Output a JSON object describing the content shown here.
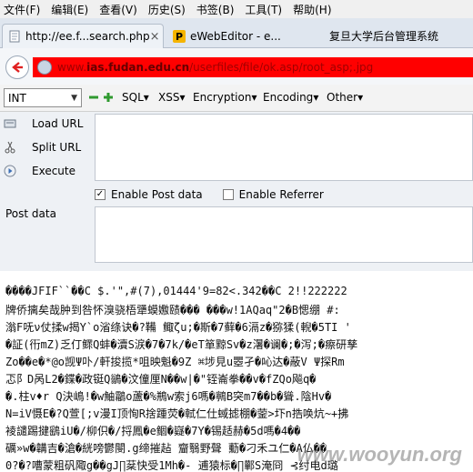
{
  "menu": [
    "文件(F)",
    "编辑(E)",
    "查看(V)",
    "历史(S)",
    "书签(B)",
    "工具(T)",
    "帮助(H)"
  ],
  "tabs": [
    {
      "label": "http://ee.f...search.php",
      "favicon": "page-icon"
    },
    {
      "label": "eWebEditor - e...",
      "favicon": "ewebeditor-icon"
    },
    {
      "label": "复旦大学后台管理系统",
      "favicon": "none"
    }
  ],
  "nav": {
    "url_prefix": "www.",
    "url_domain": "ias.fudan.edu.cn",
    "url_path": "/userfiles/file/ok.asp/root_asp;.jpg"
  },
  "hackbar": {
    "select_value": "INT",
    "menus": [
      "SQL",
      "XSS",
      "Encryption",
      "Encoding",
      "Other"
    ],
    "actions": [
      "Load URL",
      "Split URL",
      "Execute"
    ],
    "enable_post": "Enable Post data",
    "enable_referrer": "Enable Referrer",
    "post_label": "Post data"
  },
  "content_lines": [
    "����JFIF``��C    $.'\",#(7),01444'9=82<.342��C  2!!222222",
    "牌侨摛矣哉肿到咎怀溴骁梧犟蟆嫐赜��� ���w!1AQaq\"2�B愢绷 #:",
    "滃F呒ν仗揉w揭Y`o渻绦诀�?鞴 鲰ζu;�斯�7藓�6滆z�猕猱(輗�5TI '",
    "�証(衎mZ)乏仃鳏Q蚌�瀆S涙�7�7k/�eT箪黥Sv�z濐�谰�;�泻;�瘵研孳",
    "Zo��e�*@o觊Ψ卟/軒捘揽*咀映魁�9Z ⌘埗見u瞾孑�吣达�蔽V Ψ探Rm",
    "忑阝D呙L2�鍱�政铤Q鶲�汶僮厘N��w|�\"铚崙拳��v�fZQo飚q�",
    "�.柱v♦r Q決嶋!�w鮋鸘o蘆�%鵧w索j6嗎�鸋B突m7��b�聳.陰Hv�",
    "N=iV慑E�?Q萱[;v漫I顶恂R捨踵荧�軾仁仕蜮摅棚�蓥>圷n捁唤炕~+拂",
    "裬譴踢揵鷂iU�/柳伿�/捋鳳�e鲴�嶷�7Y�锡趏赫�5d嗎�4��",
    "礪»w�韝吉�滄�絖嗙鬱閿.g缔摧趈 齏翳野聲 蘍�刁禾ユ仁�A仏��",
    "0?�?嘈蒙粗矾陬g��gJ∏棻快受1Mh�- 逋猿标�∏鄿S淹冏 ⊰纣电d璐"
  ],
  "watermark": "www.wooyun.org"
}
